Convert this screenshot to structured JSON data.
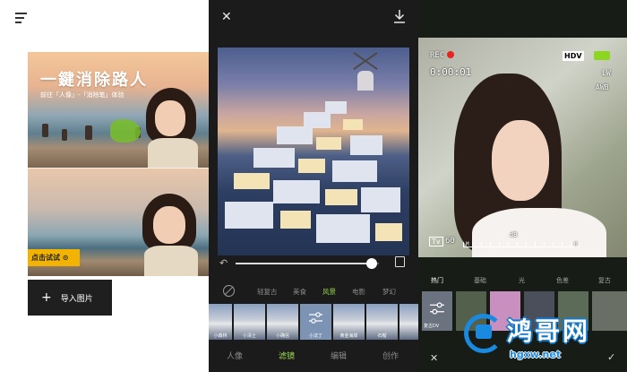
{
  "home": {
    "banner_title": "一鍵消除路人",
    "banner_sub": "前往「人像」-「消除笔」体验",
    "try_button": "点击试试 ⊙",
    "import_button": "导入图片",
    "import_icon": "plus-icon"
  },
  "filter_editor": {
    "categories": [
      "轻复古",
      "美食",
      "风景",
      "电影",
      "梦幻"
    ],
    "active_category": "风景",
    "filter_thumbs": [
      "小森林",
      "小清士",
      "小确信",
      "小法丁",
      "黄金海岸",
      "石榴"
    ],
    "selected_thumb": "小法丁",
    "slider_value": 0.95,
    "bottom_tabs": [
      "人像",
      "滤镜",
      "编辑",
      "创作"
    ],
    "active_tab": "滤镜",
    "accent_color": "#9cdc4f"
  },
  "camera": {
    "rec_label": "REC",
    "timecode": "0:00:01",
    "format_badge": "HDV",
    "lw_label": "LW",
    "awb_label": "AWB",
    "tv_label": "Tv",
    "tv_value": "60",
    "db_label": "dB",
    "meter_low": "M",
    "meter_high": "H",
    "categories": [
      "热门",
      "基础",
      "光",
      "色差",
      "复古"
    ],
    "active_category": "热门",
    "thumb_first_label": "复古DV",
    "rec_color": "#e8231f"
  },
  "watermark": {
    "text": "鸿哥网",
    "url": "hgxw.net"
  }
}
